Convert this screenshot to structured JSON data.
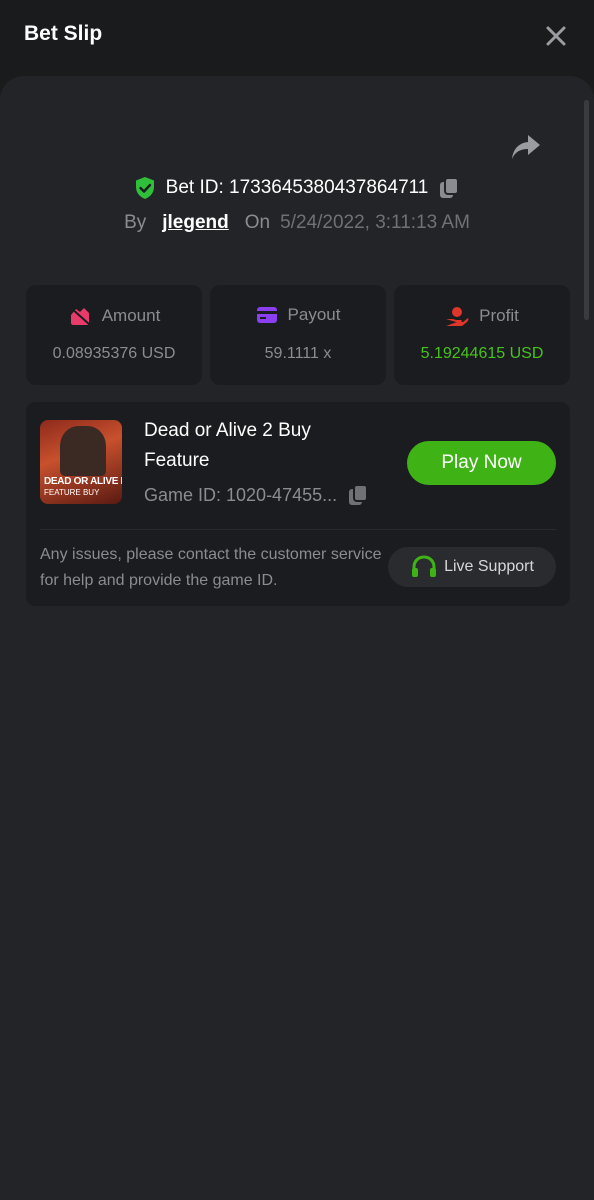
{
  "header": {
    "title": "Bet Slip"
  },
  "bet": {
    "id_text": "Bet ID: 1733645380437864711",
    "by_label": "By",
    "user": "jlegend",
    "on_label": "On",
    "date": "5/24/2022, 3:11:13 AM"
  },
  "stats": [
    {
      "label": "Amount",
      "value": "0.08935376 USD",
      "icon": "amount-icon",
      "color": "#e83b6a"
    },
    {
      "label": "Payout",
      "value": "59.1111 x",
      "icon": "payout-icon",
      "color": "#8a3ff0"
    },
    {
      "label": "Profit",
      "value": "5.19244615 USD",
      "icon": "profit-icon",
      "color": "#e0352b"
    }
  ],
  "game": {
    "name": "Dead or Alive 2 Buy Feature",
    "id_text": "Game ID: 1020-47455...",
    "thumb_title": "DEAD OR ALIVE II",
    "thumb_sub": "FEATURE BUY",
    "play_label": "Play Now",
    "issues_text": "Any issues, please contact the customer service for help and provide the game ID.",
    "support_label": "Live Support"
  },
  "colors": {
    "accent_green": "#3fb316",
    "profit_green": "#46c31a",
    "shield_green": "#2fbf3a"
  }
}
